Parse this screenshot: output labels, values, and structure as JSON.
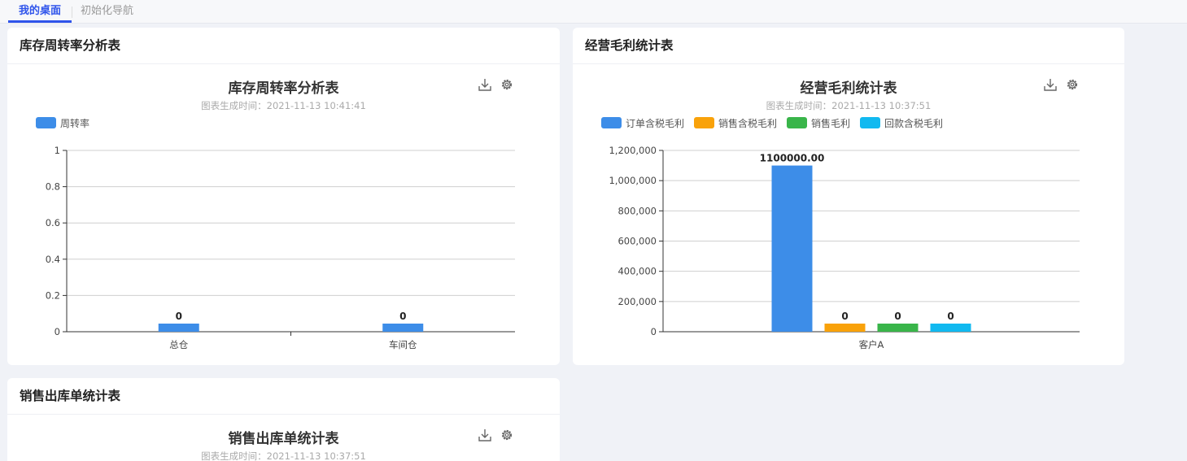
{
  "tabs": [
    {
      "label": "我的桌面",
      "active": true
    },
    {
      "label": "初始化导航",
      "active": false
    }
  ],
  "colors": {
    "accent": "#2f54eb",
    "blue": "#3d8de8",
    "orange": "#f9a20a",
    "green": "#39b54a",
    "cyan": "#11b9f0"
  },
  "cards": {
    "turnover": {
      "header": "库存周转率分析表",
      "title": "库存周转率分析表",
      "subtitle": "图表生成时间：2021-11-13 10:41:41"
    },
    "profit": {
      "header": "经营毛利统计表",
      "title": "经营毛利统计表",
      "subtitle": "图表生成时间：2021-11-13 10:37:51"
    },
    "sales": {
      "header": "销售出库单统计表",
      "title": "销售出库单统计表",
      "subtitle": "图表生成时间：2021-11-13 10:37:51"
    }
  },
  "toolbar": {
    "download_icon": "download-icon",
    "settings_icon": "gear-icon"
  },
  "chart_data": [
    {
      "type": "bar",
      "title": "库存周转率分析表",
      "categories": [
        "总仓",
        "车间仓"
      ],
      "series": [
        {
          "name": "周转率",
          "values": [
            0,
            0
          ],
          "labels": [
            "0",
            "0"
          ],
          "color": "#3d8de8"
        }
      ],
      "ylim": [
        0,
        1
      ],
      "yticks": [
        0,
        0.2,
        0.4,
        0.6,
        0.8,
        1
      ],
      "ytick_labels": [
        "0",
        "0.2",
        "0.4",
        "0.6",
        "0.8",
        "1"
      ],
      "grid": true,
      "legend": "top-left"
    },
    {
      "type": "bar",
      "title": "经营毛利统计表",
      "categories": [
        "客户A"
      ],
      "series": [
        {
          "name": "订单含税毛利",
          "values": [
            1100000
          ],
          "labels": [
            "1100000.00"
          ],
          "color": "#3d8de8"
        },
        {
          "name": "销售含税毛利",
          "values": [
            0
          ],
          "labels": [
            "0"
          ],
          "color": "#f9a20a"
        },
        {
          "name": "销售毛利",
          "values": [
            0
          ],
          "labels": [
            "0"
          ],
          "color": "#39b54a"
        },
        {
          "name": "回款含税毛利",
          "values": [
            0
          ],
          "labels": [
            "0"
          ],
          "color": "#11b9f0"
        }
      ],
      "ylim": [
        0,
        1200000
      ],
      "yticks": [
        0,
        200000,
        400000,
        600000,
        800000,
        1000000,
        1200000
      ],
      "ytick_labels": [
        "0",
        "200,000",
        "400,000",
        "600,000",
        "800,000",
        "1,000,000",
        "1,200,000"
      ],
      "grid": true,
      "legend": "top-left"
    }
  ]
}
